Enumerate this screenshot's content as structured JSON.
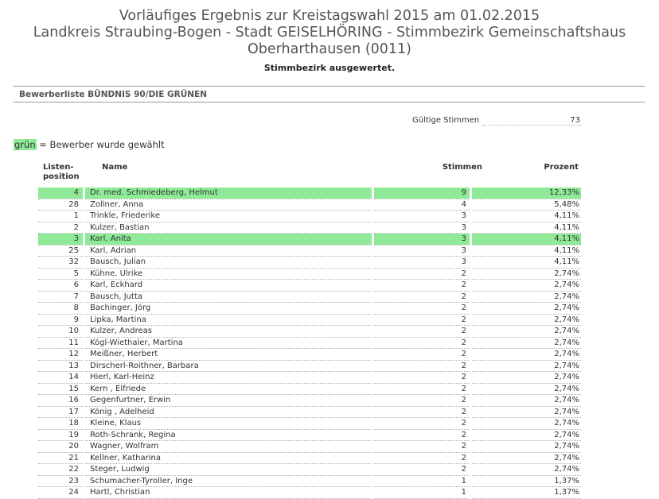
{
  "header": {
    "title_lines": [
      "Vorläufiges Ergebnis zur Kreistagswahl 2015 am 01.02.2015",
      "Landkreis Straubing-Bogen - Stadt GEISELHÖRING - Stimmbezirk Gemeinschaftshaus",
      "Oberharthausen (0011)"
    ],
    "status": "Stimmbezirk ausgewertet."
  },
  "list_title": "Bewerberliste BÜNDNIS 90/DIE GRÜNEN",
  "valid_votes": {
    "label": "Gültige Stimmen",
    "value": "73"
  },
  "legend": {
    "swatch_text": "grün",
    "text": " = Bewerber wurde gewählt"
  },
  "colors": {
    "elected_highlight": "#8eea96",
    "title_text": "#555555"
  },
  "columns": {
    "pos_line1": "Listen-",
    "pos_line2": "position",
    "name": "Name",
    "votes": "Stimmen",
    "percent": "Prozent"
  },
  "rows": [
    {
      "pos": "4",
      "name": "Dr. med. Schmiedeberg, Helmut",
      "votes": "9",
      "pct": "12,33%",
      "elected": true
    },
    {
      "pos": "28",
      "name": "Zollner, Anna",
      "votes": "4",
      "pct": "5,48%",
      "elected": false
    },
    {
      "pos": "1",
      "name": "Trinkle, Friederike",
      "votes": "3",
      "pct": "4,11%",
      "elected": false
    },
    {
      "pos": "2",
      "name": "Kulzer, Bastian",
      "votes": "3",
      "pct": "4,11%",
      "elected": false
    },
    {
      "pos": "3",
      "name": "Karl, Anita",
      "votes": "3",
      "pct": "4,11%",
      "elected": true
    },
    {
      "pos": "25",
      "name": "Karl, Adrian",
      "votes": "3",
      "pct": "4,11%",
      "elected": false
    },
    {
      "pos": "32",
      "name": "Bausch, Julian",
      "votes": "3",
      "pct": "4,11%",
      "elected": false
    },
    {
      "pos": "5",
      "name": "Kühne, Ulrike",
      "votes": "2",
      "pct": "2,74%",
      "elected": false
    },
    {
      "pos": "6",
      "name": "Karl, Eckhard",
      "votes": "2",
      "pct": "2,74%",
      "elected": false
    },
    {
      "pos": "7",
      "name": "Bausch, Jutta",
      "votes": "2",
      "pct": "2,74%",
      "elected": false
    },
    {
      "pos": "8",
      "name": "Bachinger, Jörg",
      "votes": "2",
      "pct": "2,74%",
      "elected": false
    },
    {
      "pos": "9",
      "name": "Lipka, Martina",
      "votes": "2",
      "pct": "2,74%",
      "elected": false
    },
    {
      "pos": "10",
      "name": "Kulzer, Andreas",
      "votes": "2",
      "pct": "2,74%",
      "elected": false
    },
    {
      "pos": "11",
      "name": "Kögl-Wiethaler, Martina",
      "votes": "2",
      "pct": "2,74%",
      "elected": false
    },
    {
      "pos": "12",
      "name": "Meißner, Herbert",
      "votes": "2",
      "pct": "2,74%",
      "elected": false
    },
    {
      "pos": "13",
      "name": "Dirscherl-Roithner, Barbara",
      "votes": "2",
      "pct": "2,74%",
      "elected": false
    },
    {
      "pos": "14",
      "name": "Hierl, Karl-Heinz",
      "votes": "2",
      "pct": "2,74%",
      "elected": false
    },
    {
      "pos": "15",
      "name": "Kern , Elfriede",
      "votes": "2",
      "pct": "2,74%",
      "elected": false
    },
    {
      "pos": "16",
      "name": "Gegenfurtner, Erwin",
      "votes": "2",
      "pct": "2,74%",
      "elected": false
    },
    {
      "pos": "17",
      "name": "König , Adelheid",
      "votes": "2",
      "pct": "2,74%",
      "elected": false
    },
    {
      "pos": "18",
      "name": "Kleine, Klaus",
      "votes": "2",
      "pct": "2,74%",
      "elected": false
    },
    {
      "pos": "19",
      "name": "Roth-Schrank, Regina",
      "votes": "2",
      "pct": "2,74%",
      "elected": false
    },
    {
      "pos": "20",
      "name": "Wagner, Wolfram",
      "votes": "2",
      "pct": "2,74%",
      "elected": false
    },
    {
      "pos": "21",
      "name": "Kellner, Katharina",
      "votes": "2",
      "pct": "2,74%",
      "elected": false
    },
    {
      "pos": "22",
      "name": "Steger, Ludwig",
      "votes": "2",
      "pct": "2,74%",
      "elected": false
    },
    {
      "pos": "23",
      "name": "Schumacher-Tyroller, Inge",
      "votes": "1",
      "pct": "1,37%",
      "elected": false
    },
    {
      "pos": "24",
      "name": "Hartl, Christian",
      "votes": "1",
      "pct": "1,37%",
      "elected": false
    }
  ]
}
